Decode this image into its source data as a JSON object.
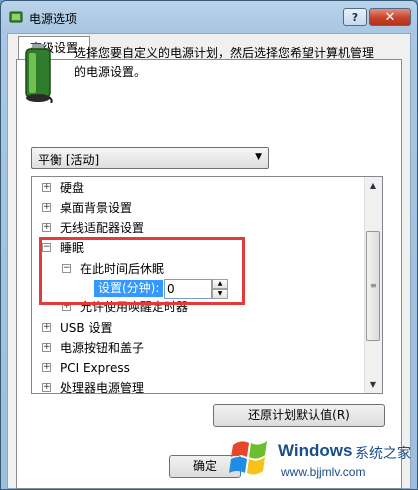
{
  "window": {
    "title": "电源选项",
    "help_label": "?",
    "close_label": "✕"
  },
  "tab": {
    "label": "高级设置"
  },
  "description": "选择您要自定义的电源计划，然后选择您希望计算机管理的电源设置。",
  "plan_select": {
    "value": "平衡 [活动]"
  },
  "tree": {
    "items": [
      {
        "label": "硬盘",
        "toggle": "+"
      },
      {
        "label": "桌面背景设置",
        "toggle": "+"
      },
      {
        "label": "无线适配器设置",
        "toggle": "+"
      },
      {
        "label": "睡眠",
        "toggle": "−"
      },
      {
        "label": "在此时间后休眠",
        "toggle": "−"
      },
      {
        "label": "允许使用唤醒定时器",
        "toggle": "+"
      },
      {
        "label": "USB 设置",
        "toggle": "+"
      },
      {
        "label": "电源按钮和盖子",
        "toggle": "+"
      },
      {
        "label": "PCI Express",
        "toggle": "+"
      },
      {
        "label": "处理器电源管理",
        "toggle": "+"
      }
    ],
    "setting_label": "设置(分钟):",
    "setting_value": "0"
  },
  "buttons": {
    "restore": "还原计划默认值(R)",
    "ok": "确定"
  },
  "watermark": {
    "brand": "Windows",
    "cn": "系统之家",
    "url": "www.bjjmlv.com"
  },
  "colors": {
    "highlight_border": "#e23b3b",
    "selection": "#3399ff"
  }
}
